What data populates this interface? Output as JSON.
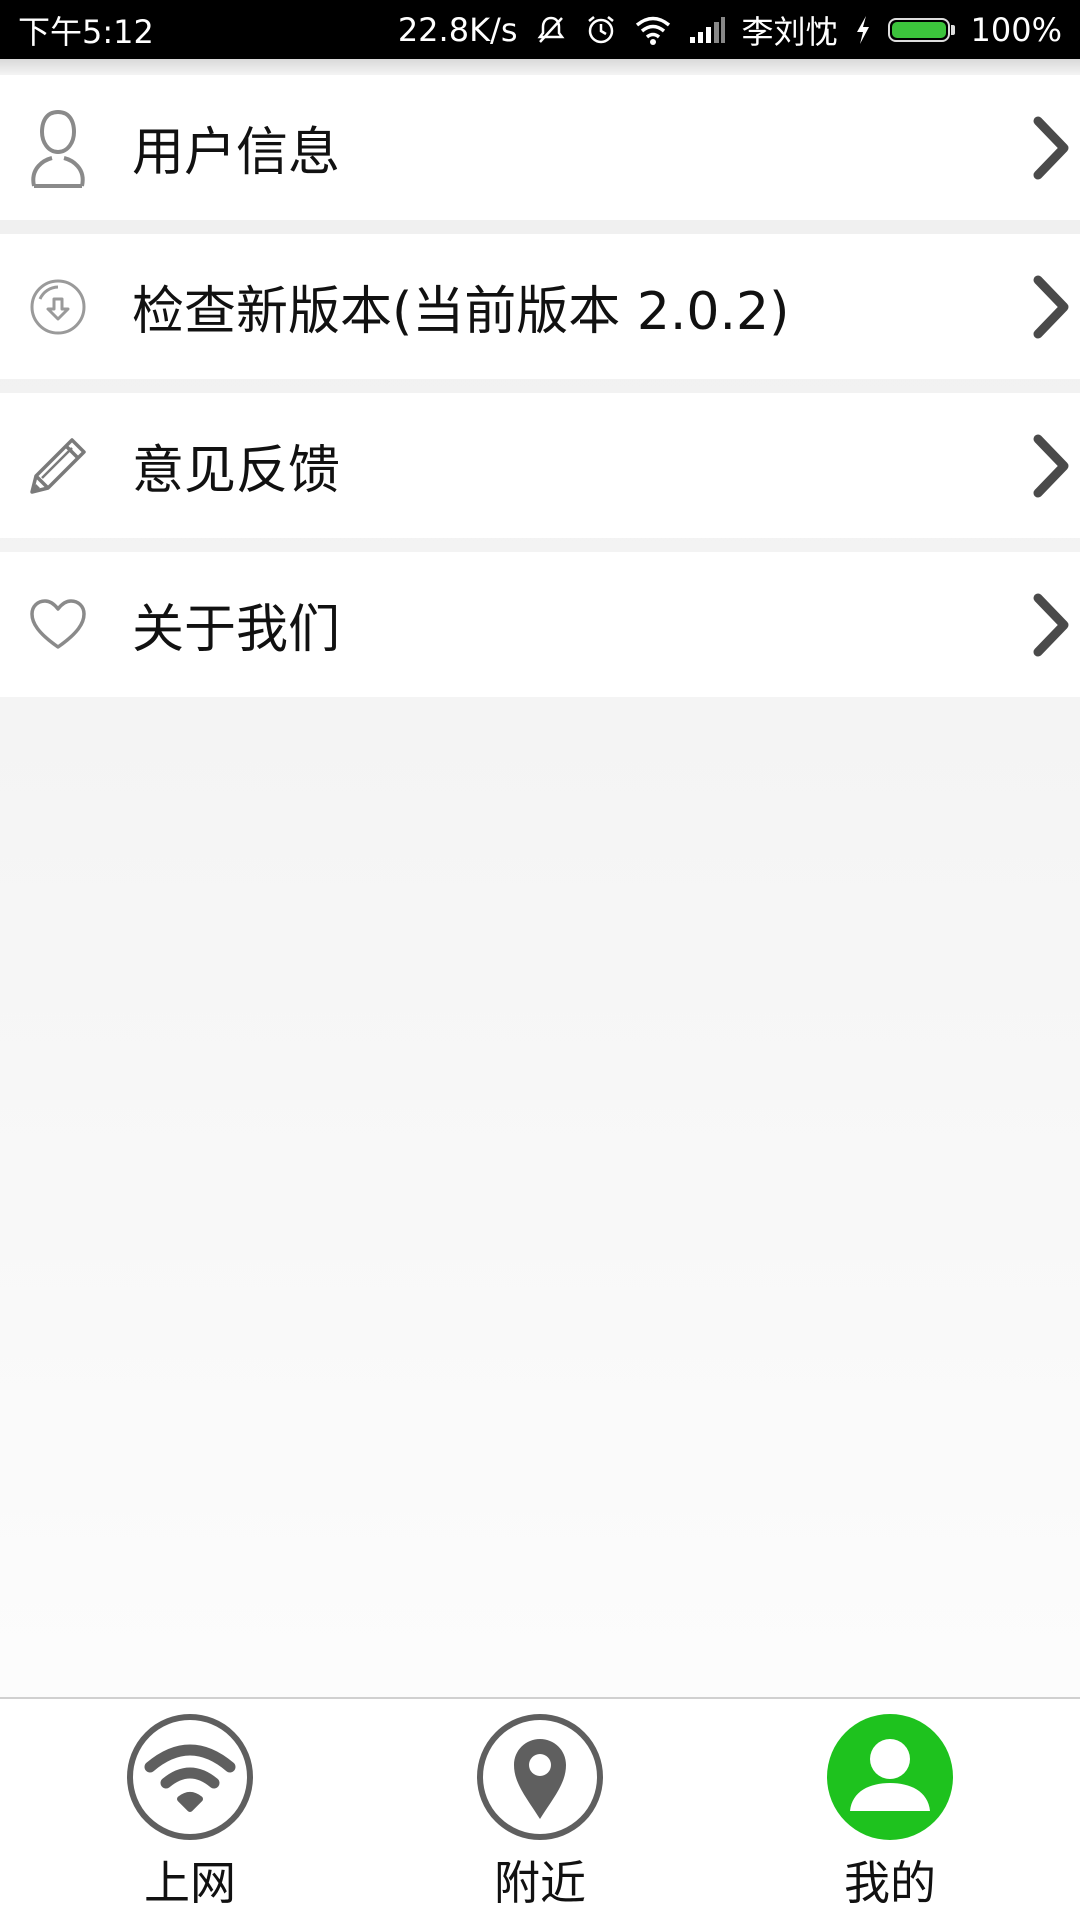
{
  "status_bar": {
    "time": "下午5:12",
    "net_speed": "22.8K/s",
    "carrier": "李刘忱",
    "battery": "100%",
    "battery_level": 1.0,
    "battery_color": "#3cc43c"
  },
  "menu": {
    "items": [
      {
        "label": "用户信息",
        "icon": "user-icon"
      },
      {
        "label": "检查新版本(当前版本 2.0.2)",
        "icon": "download-circle-icon"
      },
      {
        "label": "意见反馈",
        "icon": "pencil-icon"
      },
      {
        "label": "关于我们",
        "icon": "heart-icon"
      }
    ]
  },
  "bottom_nav": {
    "active_color": "#1ec21e",
    "items": [
      {
        "label": "上网",
        "icon": "wifi-icon",
        "active": false
      },
      {
        "label": "附近",
        "icon": "location-pin-icon",
        "active": false
      },
      {
        "label": "我的",
        "icon": "person-icon",
        "active": true
      }
    ]
  }
}
